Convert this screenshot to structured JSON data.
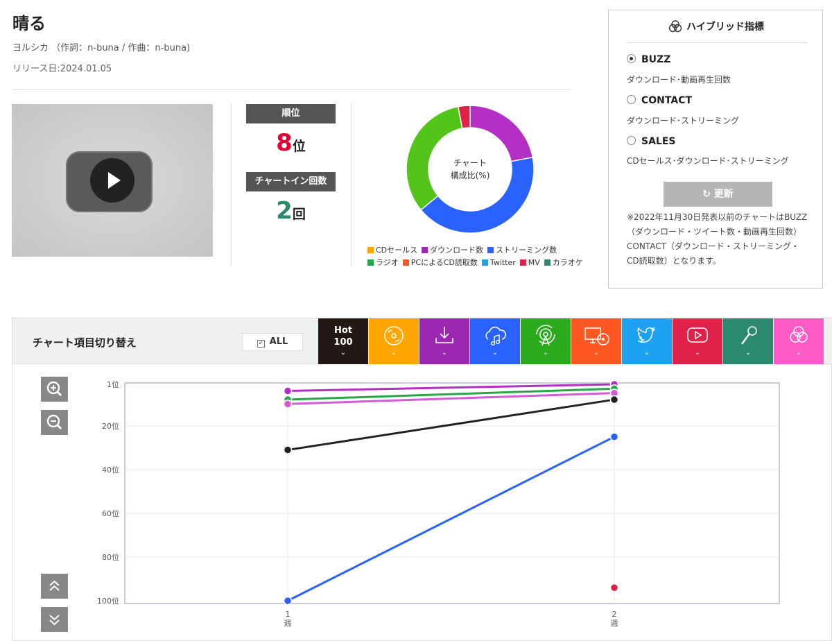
{
  "song": {
    "title": "晴る",
    "artist_line": "ヨルシカ （作詞：n-buna / 作曲：n-buna)",
    "release": "リリース日:2024.01.05"
  },
  "video": {
    "icon": "youtube-play-icon"
  },
  "rank": {
    "label": "順位",
    "value": "8",
    "unit": "位",
    "value_color": "#e60033",
    "chart_in_label": "チャートイン回数",
    "chart_in_value": "2",
    "chart_in_unit": "回",
    "chart_in_color": "#2b8a6d"
  },
  "donut": {
    "center_line1": "チャート",
    "center_line2": "構成比(%)",
    "segments": [
      {
        "name": "ダウンロード数",
        "value": 22,
        "color": "#b42fc4"
      },
      {
        "name": "ストリーミング数",
        "value": 42,
        "color": "#2962ff"
      },
      {
        "name": "ラジオ",
        "value": 33,
        "color": "#52c41a"
      },
      {
        "name": "MV",
        "value": 3,
        "color": "#e0224a"
      }
    ]
  },
  "legend": {
    "row1": [
      {
        "label": "CDセールス",
        "color": "#ffa500"
      },
      {
        "label": "ダウンロード数",
        "color": "#9c27b0"
      },
      {
        "label": "ストリーミング数",
        "color": "#2962ff"
      }
    ],
    "row2": [
      {
        "label": "ラジオ",
        "color": "#28a745"
      },
      {
        "label": "PCによるCD読取数",
        "color": "#ff5722"
      },
      {
        "label": "Twitter",
        "color": "#1da1f2"
      },
      {
        "label": "MV",
        "color": "#e0224a"
      },
      {
        "label": "カラオケ",
        "color": "#2b8a6d"
      }
    ]
  },
  "hybrid": {
    "title": "ハイブリッド指標",
    "icon": "hybrid-circles-icon",
    "options": [
      {
        "label": "BUZZ",
        "desc": "ダウンロード･動画再生回数",
        "selected": true
      },
      {
        "label": "CONTACT",
        "desc": "ダウンロード･ストリーミング",
        "selected": false
      },
      {
        "label": "SALES",
        "desc": "CDセールス･ダウンロード･ストリーミング",
        "selected": false
      }
    ],
    "update_label": "更新",
    "update_icon": "refresh-icon",
    "note": "※2022年11月30日発表以前のチャートはBUZZ（ダウンロード・ツイート数・動画再生回数）CONTACT（ダウンロード・ストリーミング・CD読取数）となります。"
  },
  "chart_toggle": {
    "label": "チャート項目切り替え",
    "all_label": "ALL",
    "chevron": "⌄",
    "categories": [
      {
        "id": "hot100",
        "label": "Hot 100",
        "icon": "hot100-icon",
        "color": "#231815"
      },
      {
        "id": "cd",
        "label": "",
        "icon": "cd-icon",
        "color": "#ffa500"
      },
      {
        "id": "download",
        "label": "",
        "icon": "download-icon",
        "color": "#9c27b0"
      },
      {
        "id": "streaming",
        "label": "",
        "icon": "cloud-music-icon",
        "color": "#2962ff"
      },
      {
        "id": "radio",
        "label": "",
        "icon": "radio-icon",
        "color": "#2aab1e"
      },
      {
        "id": "pc",
        "label": "",
        "icon": "pc-cd-icon",
        "color": "#ff5722"
      },
      {
        "id": "twitter",
        "label": "",
        "icon": "twitter-icon",
        "color": "#1da1f2"
      },
      {
        "id": "youtube",
        "label": "",
        "icon": "youtube-icon",
        "color": "#e0224a"
      },
      {
        "id": "karaoke",
        "label": "",
        "icon": "microphone-icon",
        "color": "#2b8a6d"
      },
      {
        "id": "hybrid",
        "label": "",
        "icon": "hybrid-circles-icon",
        "color": "#ff5bc8"
      }
    ]
  },
  "chart_data": {
    "type": "line",
    "x": [
      1,
      2
    ],
    "x_tick_labels": [
      [
        "1",
        "週"
      ],
      [
        "2",
        "週"
      ]
    ],
    "y_tick_labels": [
      "1位",
      "20位",
      "40位",
      "60位",
      "80位",
      "100位"
    ],
    "y_ticks": [
      1,
      20,
      40,
      60,
      80,
      100
    ],
    "ylim": [
      1,
      100
    ],
    "y_inverted": true,
    "series": [
      {
        "color": "#b42fc4",
        "values": [
          4,
          1
        ]
      },
      {
        "color": "#28a745",
        "values": [
          8,
          3
        ]
      },
      {
        "color": "#d65ad6",
        "values": [
          10,
          5
        ]
      },
      {
        "color": "#222222",
        "values": [
          31,
          8
        ]
      },
      {
        "color": "#2962ff",
        "values": [
          100,
          25
        ]
      },
      {
        "color": "#e0224a",
        "values": [
          null,
          94
        ]
      }
    ]
  }
}
